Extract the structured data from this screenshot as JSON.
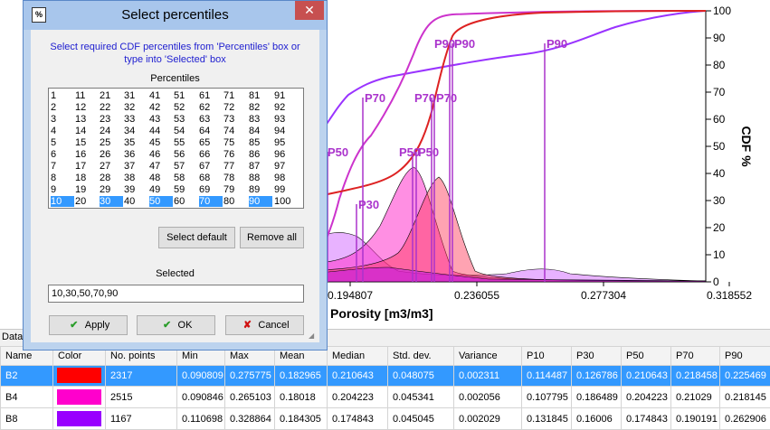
{
  "dialog": {
    "title": "Select percentiles",
    "app_icon": "%",
    "close_glyph": "✕",
    "instructions_line1": "Select required CDF percentiles from 'Percentiles' box or",
    "instructions_line2": "type into 'Selected' box",
    "percentiles_label": "Percentiles",
    "percentiles": [
      "1",
      "2",
      "3",
      "4",
      "5",
      "6",
      "7",
      "8",
      "9",
      "10",
      "11",
      "12",
      "13",
      "14",
      "15",
      "16",
      "17",
      "18",
      "19",
      "20",
      "21",
      "22",
      "23",
      "24",
      "25",
      "26",
      "27",
      "28",
      "29",
      "30",
      "31",
      "32",
      "33",
      "34",
      "35",
      "36",
      "37",
      "38",
      "39",
      "40",
      "41",
      "42",
      "43",
      "44",
      "45",
      "46",
      "47",
      "48",
      "49",
      "50",
      "51",
      "52",
      "53",
      "54",
      "55",
      "56",
      "57",
      "58",
      "59",
      "60",
      "61",
      "62",
      "63",
      "64",
      "65",
      "66",
      "67",
      "68",
      "69",
      "70",
      "71",
      "72",
      "73",
      "74",
      "75",
      "76",
      "77",
      "78",
      "79",
      "80",
      "81",
      "82",
      "83",
      "84",
      "85",
      "86",
      "87",
      "88",
      "89",
      "90",
      "91",
      "92",
      "93",
      "94",
      "95",
      "96",
      "97",
      "98",
      "99",
      "100"
    ],
    "selected_percentiles": [
      "10",
      "30",
      "50",
      "70",
      "90"
    ],
    "select_default_label": "Select default",
    "remove_all_label": "Remove all",
    "selected_label": "Selected",
    "selected_value": "10,30,50,70,90",
    "apply_label": "Apply",
    "ok_label": "OK",
    "cancel_label": "Cancel",
    "apply_icon": "check-icon",
    "ok_icon": "check-icon",
    "cancel_icon": "x-icon"
  },
  "chart_data": {
    "type": "area",
    "xlabel": "Porosity [m3/m3]",
    "ylabel": "CDF %",
    "x_ticks": [
      "0.194807",
      "0.236055",
      "0.277304",
      "0.318552"
    ],
    "y_ticks": [
      "0",
      "10",
      "20",
      "30",
      "40",
      "50",
      "60",
      "70",
      "80",
      "90",
      "100"
    ],
    "ylim": [
      0,
      100
    ],
    "markers": [
      {
        "label": "P90",
        "x": 0.2194,
        "series": "B4"
      },
      {
        "label": "P90",
        "x": 0.2255,
        "series": "B2"
      },
      {
        "label": "P90",
        "x": 0.2629,
        "series": "B8"
      },
      {
        "label": "P70",
        "x": 0.1902,
        "series": "B8"
      },
      {
        "label": "P70",
        "x": 0.2103,
        "series": "B4"
      },
      {
        "label": "P70",
        "x": 0.2185,
        "series": "B2"
      },
      {
        "label": "P50",
        "x": 0.1748,
        "series": "B8"
      },
      {
        "label": "P50",
        "x": 0.2042,
        "series": "B4"
      },
      {
        "label": "P50",
        "x": 0.2106,
        "series": "B2"
      },
      {
        "label": "P30",
        "x": 0.1861,
        "series": "B4"
      }
    ],
    "series": [
      {
        "name": "B2",
        "color": "#ff0000"
      },
      {
        "name": "B4",
        "color": "#ff00cc"
      },
      {
        "name": "B8",
        "color": "#9900ff"
      }
    ]
  },
  "data_strip": {
    "label": "Data"
  },
  "table": {
    "headers": [
      "Name",
      "Color",
      "No. points",
      "Min",
      "Max",
      "Mean",
      "Median",
      "Std. dev.",
      "Variance",
      "P10",
      "P30",
      "P50",
      "P70",
      "P90"
    ],
    "rows": [
      {
        "name": "B2",
        "color": "#ff0000",
        "points": "2317",
        "min": "0.090809",
        "max": "0.275775",
        "mean": "0.182965",
        "median": "0.210643",
        "std": "0.048075",
        "variance": "0.002311",
        "p10": "0.114487",
        "p30": "0.126786",
        "p50": "0.210643",
        "p70": "0.218458",
        "p90": "0.225469"
      },
      {
        "name": "B4",
        "color": "#ff00cc",
        "points": "2515",
        "min": "0.090846",
        "max": "0.265103",
        "mean": "0.18018",
        "median": "0.204223",
        "std": "0.045341",
        "variance": "0.002056",
        "p10": "0.107795",
        "p30": "0.186489",
        "p50": "0.204223",
        "p70": "0.21029",
        "p90": "0.218145"
      },
      {
        "name": "B8",
        "color": "#9900ff",
        "points": "1167",
        "min": "0.110698",
        "max": "0.328864",
        "mean": "0.184305",
        "median": "0.174843",
        "std": "0.045045",
        "variance": "0.002029",
        "p10": "0.131845",
        "p30": "0.16006",
        "p50": "0.174843",
        "p70": "0.190191",
        "p90": "0.262906"
      }
    ]
  }
}
